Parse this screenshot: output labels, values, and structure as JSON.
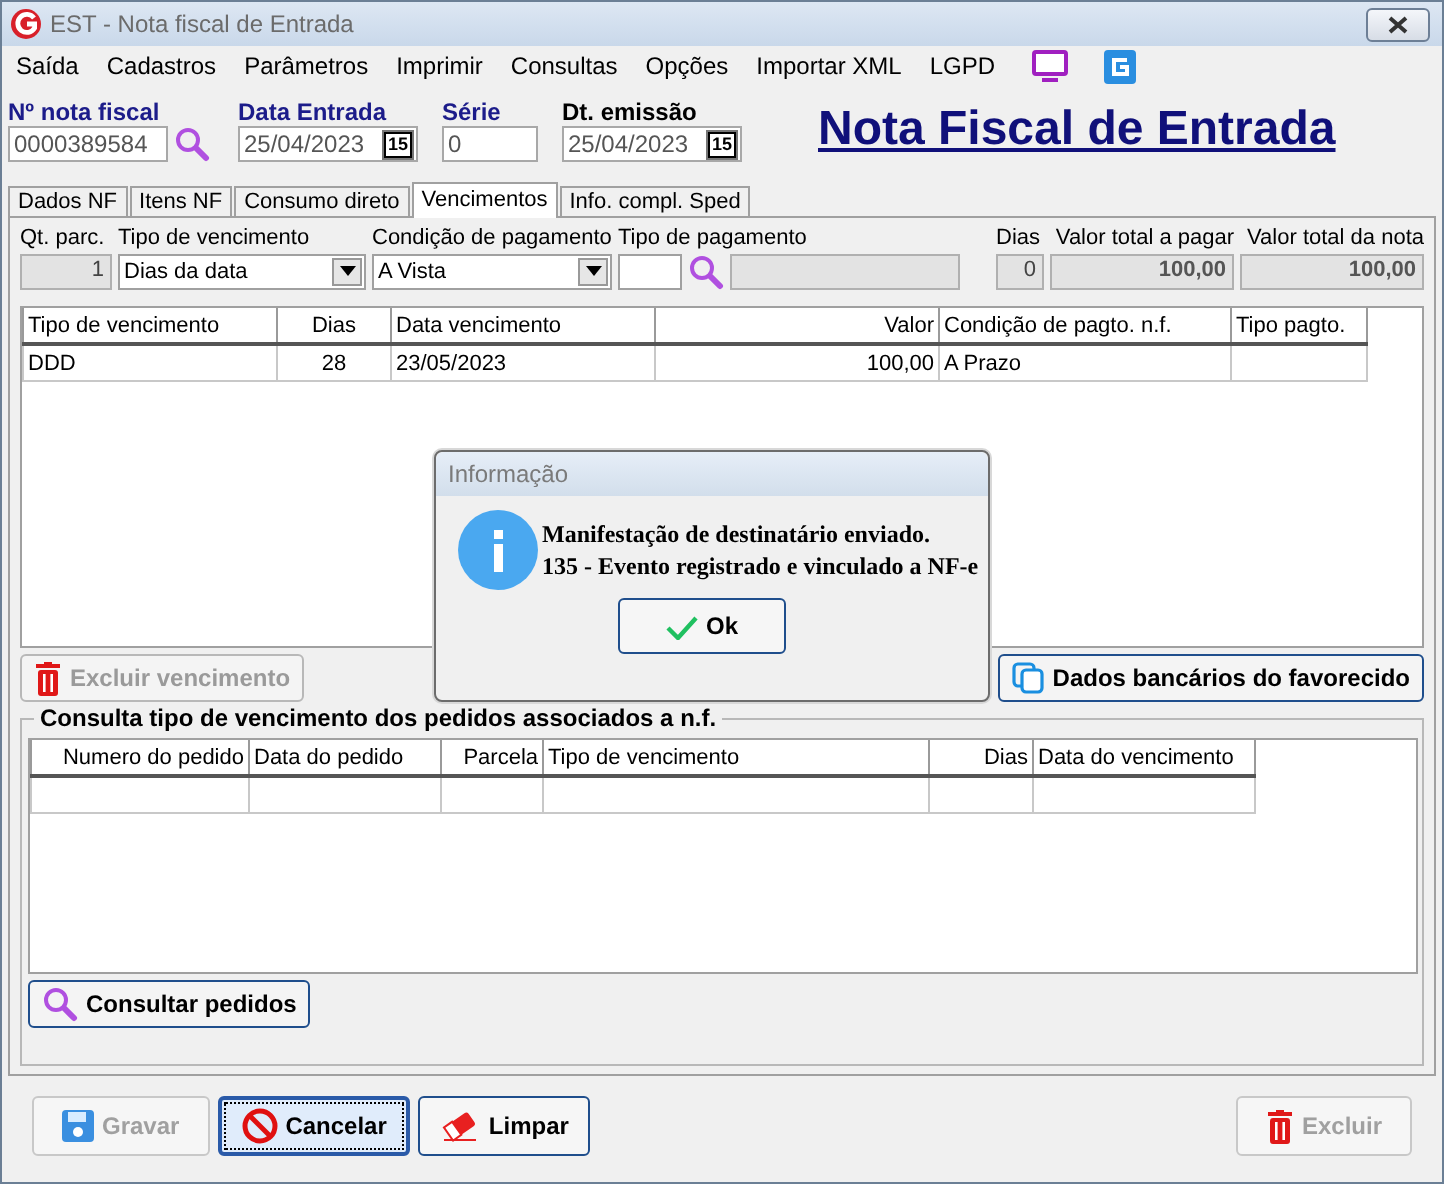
{
  "window": {
    "title": "EST - Nota fiscal de Entrada"
  },
  "menu": [
    "Saída",
    "Cadastros",
    "Parâmetros",
    "Imprimir",
    "Consultas",
    "Opções",
    "Importar XML",
    "LGPD"
  ],
  "header_fields": [
    {
      "label": "Nº nota fiscal",
      "value": "0000389584",
      "kind": "search"
    },
    {
      "label": "Data Entrada",
      "value": "25/04/2023",
      "kind": "date",
      "calendar": "15"
    },
    {
      "label": "Série",
      "value": "0",
      "kind": "text"
    },
    {
      "label": "Dt. emissão",
      "value": "25/04/2023",
      "kind": "date",
      "calendar": "15"
    }
  ],
  "page_title": "Nota Fiscal de Entrada",
  "tabs": [
    {
      "label": "Dados NF",
      "selected": false
    },
    {
      "label": "Itens NF",
      "selected": false
    },
    {
      "label": "Consumo direto",
      "selected": false
    },
    {
      "label": "Vencimentos",
      "selected": true
    },
    {
      "label": "Info. compl. Sped",
      "selected": false
    }
  ],
  "fields": [
    {
      "label": "Qt. parc.",
      "value": "1",
      "kind": "readonly"
    },
    {
      "label": "Tipo de vencimento",
      "value": "Dias da data",
      "kind": "dropdown"
    },
    {
      "label": "Condição de pagamento",
      "value": "A Vista",
      "kind": "dropdown"
    },
    {
      "label": "Tipo de pagamento",
      "kind": "lookup"
    },
    {
      "label": "Dias",
      "value": "0",
      "kind": "readonly"
    },
    {
      "label": "Valor total a pagar",
      "value": "100,00",
      "kind": "readonly"
    },
    {
      "label": "Valor total da nota",
      "value": "100,00",
      "kind": "readonly"
    }
  ],
  "installments_table": {
    "columns": [
      "Tipo de vencimento",
      "Dias",
      "Data vencimento",
      "Valor",
      "Condição de pagto. n.f.",
      "Tipo pagto."
    ],
    "rows": [
      [
        "DDD",
        "28",
        "23/05/2023",
        "100,00",
        "A Prazo",
        ""
      ]
    ]
  },
  "delete_button": {
    "label": "Excluir vencimento",
    "disabled": true
  },
  "bank_button": {
    "label": "Dados bancários do favorecido"
  },
  "orders_group": {
    "title": "Consulta tipo de vencimento dos pedidos associados a n.f.",
    "columns": [
      "Numero do pedido",
      "Data do pedido",
      "Parcela",
      "Tipo de vencimento",
      "Dias",
      "Data do vencimento"
    ],
    "rows": [
      [
        "",
        "",
        "",
        "",
        "",
        ""
      ]
    ],
    "button": "Consultar pedidos"
  },
  "footer_buttons": [
    {
      "label": "Gravar",
      "kind": "save",
      "disabled": true,
      "focused": false
    },
    {
      "label": "Cancelar",
      "kind": "cancel",
      "disabled": false,
      "focused": true
    },
    {
      "label": "Limpar",
      "kind": "clear",
      "disabled": false,
      "focused": false
    },
    {
      "label": "Excluir",
      "kind": "delete",
      "disabled": true,
      "focused": false
    }
  ],
  "dialog": {
    "title": "Informação",
    "message": [
      "Manifestação de destinatário enviado.",
      "135 - Evento registrado e vinculado a NF-e"
    ],
    "button": "Ok"
  }
}
